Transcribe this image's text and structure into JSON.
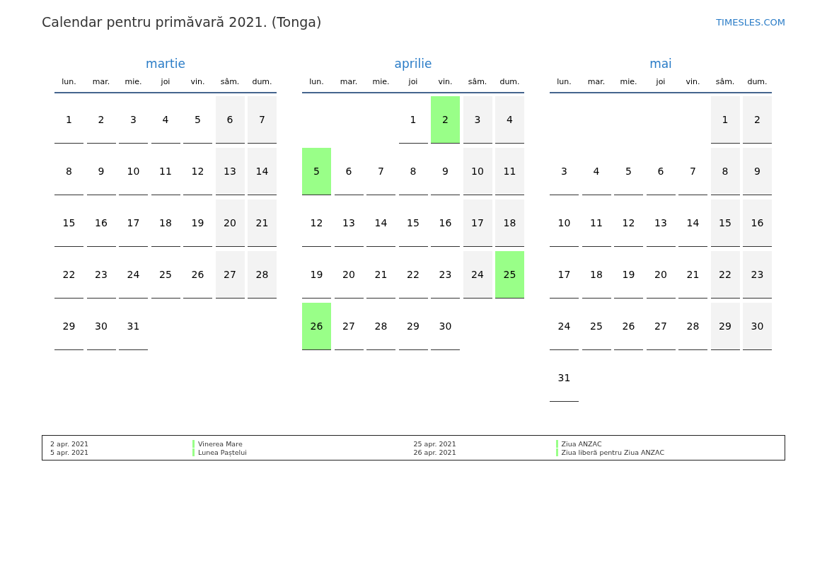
{
  "title": "Calendar pentru primăvară 2021. (Tonga)",
  "site_link": "TIMESLES.COM",
  "months": [
    {
      "name": "martie",
      "weekdays": [
        "lun.",
        "mar.",
        "mie.",
        "joi",
        "vin.",
        "sâm.",
        "dum."
      ],
      "weeks": [
        [
          {
            "kind": "day",
            "day": "1",
            "weekend": false,
            "holiday": false
          },
          {
            "kind": "day",
            "day": "2",
            "weekend": false,
            "holiday": false
          },
          {
            "kind": "day",
            "day": "3",
            "weekend": false,
            "holiday": false
          },
          {
            "kind": "day",
            "day": "4",
            "weekend": false,
            "holiday": false
          },
          {
            "kind": "day",
            "day": "5",
            "weekend": false,
            "holiday": false
          },
          {
            "kind": "day",
            "day": "6",
            "weekend": true,
            "holiday": false
          },
          {
            "kind": "day",
            "day": "7",
            "weekend": true,
            "holiday": false
          }
        ],
        [
          {
            "kind": "day",
            "day": "8",
            "weekend": false,
            "holiday": false
          },
          {
            "kind": "day",
            "day": "9",
            "weekend": false,
            "holiday": false
          },
          {
            "kind": "day",
            "day": "10",
            "weekend": false,
            "holiday": false
          },
          {
            "kind": "day",
            "day": "11",
            "weekend": false,
            "holiday": false
          },
          {
            "kind": "day",
            "day": "12",
            "weekend": false,
            "holiday": false
          },
          {
            "kind": "day",
            "day": "13",
            "weekend": true,
            "holiday": false
          },
          {
            "kind": "day",
            "day": "14",
            "weekend": true,
            "holiday": false
          }
        ],
        [
          {
            "kind": "day",
            "day": "15",
            "weekend": false,
            "holiday": false
          },
          {
            "kind": "day",
            "day": "16",
            "weekend": false,
            "holiday": false
          },
          {
            "kind": "day",
            "day": "17",
            "weekend": false,
            "holiday": false
          },
          {
            "kind": "day",
            "day": "18",
            "weekend": false,
            "holiday": false
          },
          {
            "kind": "day",
            "day": "19",
            "weekend": false,
            "holiday": false
          },
          {
            "kind": "day",
            "day": "20",
            "weekend": true,
            "holiday": false
          },
          {
            "kind": "day",
            "day": "21",
            "weekend": true,
            "holiday": false
          }
        ],
        [
          {
            "kind": "day",
            "day": "22",
            "weekend": false,
            "holiday": false
          },
          {
            "kind": "day",
            "day": "23",
            "weekend": false,
            "holiday": false
          },
          {
            "kind": "day",
            "day": "24",
            "weekend": false,
            "holiday": false
          },
          {
            "kind": "day",
            "day": "25",
            "weekend": false,
            "holiday": false
          },
          {
            "kind": "day",
            "day": "26",
            "weekend": false,
            "holiday": false
          },
          {
            "kind": "day",
            "day": "27",
            "weekend": true,
            "holiday": false
          },
          {
            "kind": "day",
            "day": "28",
            "weekend": true,
            "holiday": false
          }
        ],
        [
          {
            "kind": "day",
            "day": "29",
            "weekend": false,
            "holiday": false
          },
          {
            "kind": "day",
            "day": "30",
            "weekend": false,
            "holiday": false
          },
          {
            "kind": "day",
            "day": "31",
            "weekend": false,
            "holiday": false
          },
          {
            "kind": "blank"
          },
          {
            "kind": "blank"
          },
          {
            "kind": "blank"
          },
          {
            "kind": "blank"
          }
        ]
      ]
    },
    {
      "name": "aprilie",
      "weekdays": [
        "lun.",
        "mar.",
        "mie.",
        "joi",
        "vin.",
        "sâm.",
        "dum."
      ],
      "weeks": [
        [
          {
            "kind": "blank"
          },
          {
            "kind": "blank"
          },
          {
            "kind": "blank"
          },
          {
            "kind": "day",
            "day": "1",
            "weekend": false,
            "holiday": false
          },
          {
            "kind": "day",
            "day": "2",
            "weekend": false,
            "holiday": true
          },
          {
            "kind": "day",
            "day": "3",
            "weekend": true,
            "holiday": false
          },
          {
            "kind": "day",
            "day": "4",
            "weekend": true,
            "holiday": false
          }
        ],
        [
          {
            "kind": "day",
            "day": "5",
            "weekend": false,
            "holiday": true
          },
          {
            "kind": "day",
            "day": "6",
            "weekend": false,
            "holiday": false
          },
          {
            "kind": "day",
            "day": "7",
            "weekend": false,
            "holiday": false
          },
          {
            "kind": "day",
            "day": "8",
            "weekend": false,
            "holiday": false
          },
          {
            "kind": "day",
            "day": "9",
            "weekend": false,
            "holiday": false
          },
          {
            "kind": "day",
            "day": "10",
            "weekend": true,
            "holiday": false
          },
          {
            "kind": "day",
            "day": "11",
            "weekend": true,
            "holiday": false
          }
        ],
        [
          {
            "kind": "day",
            "day": "12",
            "weekend": false,
            "holiday": false
          },
          {
            "kind": "day",
            "day": "13",
            "weekend": false,
            "holiday": false
          },
          {
            "kind": "day",
            "day": "14",
            "weekend": false,
            "holiday": false
          },
          {
            "kind": "day",
            "day": "15",
            "weekend": false,
            "holiday": false
          },
          {
            "kind": "day",
            "day": "16",
            "weekend": false,
            "holiday": false
          },
          {
            "kind": "day",
            "day": "17",
            "weekend": true,
            "holiday": false
          },
          {
            "kind": "day",
            "day": "18",
            "weekend": true,
            "holiday": false
          }
        ],
        [
          {
            "kind": "day",
            "day": "19",
            "weekend": false,
            "holiday": false
          },
          {
            "kind": "day",
            "day": "20",
            "weekend": false,
            "holiday": false
          },
          {
            "kind": "day",
            "day": "21",
            "weekend": false,
            "holiday": false
          },
          {
            "kind": "day",
            "day": "22",
            "weekend": false,
            "holiday": false
          },
          {
            "kind": "day",
            "day": "23",
            "weekend": false,
            "holiday": false
          },
          {
            "kind": "day",
            "day": "24",
            "weekend": true,
            "holiday": false
          },
          {
            "kind": "day",
            "day": "25",
            "weekend": true,
            "holiday": true
          }
        ],
        [
          {
            "kind": "day",
            "day": "26",
            "weekend": false,
            "holiday": true
          },
          {
            "kind": "day",
            "day": "27",
            "weekend": false,
            "holiday": false
          },
          {
            "kind": "day",
            "day": "28",
            "weekend": false,
            "holiday": false
          },
          {
            "kind": "day",
            "day": "29",
            "weekend": false,
            "holiday": false
          },
          {
            "kind": "day",
            "day": "30",
            "weekend": false,
            "holiday": false
          },
          {
            "kind": "blank"
          },
          {
            "kind": "blank"
          }
        ]
      ]
    },
    {
      "name": "mai",
      "weekdays": [
        "lun.",
        "mar.",
        "mie.",
        "joi",
        "vin.",
        "sâm.",
        "dum."
      ],
      "weeks": [
        [
          {
            "kind": "blank"
          },
          {
            "kind": "blank"
          },
          {
            "kind": "blank"
          },
          {
            "kind": "blank"
          },
          {
            "kind": "blank"
          },
          {
            "kind": "day",
            "day": "1",
            "weekend": true,
            "holiday": false
          },
          {
            "kind": "day",
            "day": "2",
            "weekend": true,
            "holiday": false
          }
        ],
        [
          {
            "kind": "day",
            "day": "3",
            "weekend": false,
            "holiday": false
          },
          {
            "kind": "day",
            "day": "4",
            "weekend": false,
            "holiday": false
          },
          {
            "kind": "day",
            "day": "5",
            "weekend": false,
            "holiday": false
          },
          {
            "kind": "day",
            "day": "6",
            "weekend": false,
            "holiday": false
          },
          {
            "kind": "day",
            "day": "7",
            "weekend": false,
            "holiday": false
          },
          {
            "kind": "day",
            "day": "8",
            "weekend": true,
            "holiday": false
          },
          {
            "kind": "day",
            "day": "9",
            "weekend": true,
            "holiday": false
          }
        ],
        [
          {
            "kind": "day",
            "day": "10",
            "weekend": false,
            "holiday": false
          },
          {
            "kind": "day",
            "day": "11",
            "weekend": false,
            "holiday": false
          },
          {
            "kind": "day",
            "day": "12",
            "weekend": false,
            "holiday": false
          },
          {
            "kind": "day",
            "day": "13",
            "weekend": false,
            "holiday": false
          },
          {
            "kind": "day",
            "day": "14",
            "weekend": false,
            "holiday": false
          },
          {
            "kind": "day",
            "day": "15",
            "weekend": true,
            "holiday": false
          },
          {
            "kind": "day",
            "day": "16",
            "weekend": true,
            "holiday": false
          }
        ],
        [
          {
            "kind": "day",
            "day": "17",
            "weekend": false,
            "holiday": false
          },
          {
            "kind": "day",
            "day": "18",
            "weekend": false,
            "holiday": false
          },
          {
            "kind": "day",
            "day": "19",
            "weekend": false,
            "holiday": false
          },
          {
            "kind": "day",
            "day": "20",
            "weekend": false,
            "holiday": false
          },
          {
            "kind": "day",
            "day": "21",
            "weekend": false,
            "holiday": false
          },
          {
            "kind": "day",
            "day": "22",
            "weekend": true,
            "holiday": false
          },
          {
            "kind": "day",
            "day": "23",
            "weekend": true,
            "holiday": false
          }
        ],
        [
          {
            "kind": "day",
            "day": "24",
            "weekend": false,
            "holiday": false
          },
          {
            "kind": "day",
            "day": "25",
            "weekend": false,
            "holiday": false
          },
          {
            "kind": "day",
            "day": "26",
            "weekend": false,
            "holiday": false
          },
          {
            "kind": "day",
            "day": "27",
            "weekend": false,
            "holiday": false
          },
          {
            "kind": "day",
            "day": "28",
            "weekend": false,
            "holiday": false
          },
          {
            "kind": "day",
            "day": "29",
            "weekend": true,
            "holiday": false
          },
          {
            "kind": "day",
            "day": "30",
            "weekend": true,
            "holiday": false
          }
        ],
        [
          {
            "kind": "day",
            "day": "31",
            "weekend": false,
            "holiday": false
          },
          {
            "kind": "blank"
          },
          {
            "kind": "blank"
          },
          {
            "kind": "blank"
          },
          {
            "kind": "blank"
          },
          {
            "kind": "blank"
          },
          {
            "kind": "blank"
          }
        ]
      ]
    }
  ],
  "legend": [
    {
      "date": "2 apr. 2021",
      "name": "Vinerea Mare",
      "color": "#99ff88"
    },
    {
      "date": "5 apr. 2021",
      "name": "Lunea Paștelui",
      "color": "#99ff88"
    },
    {
      "date": "25 apr. 2021",
      "name": "Ziua ANZAC",
      "color": "#99ff88"
    },
    {
      "date": "26 apr. 2021",
      "name": "Ziua liberă pentru Ziua ANZAC",
      "color": "#99ff88"
    }
  ]
}
